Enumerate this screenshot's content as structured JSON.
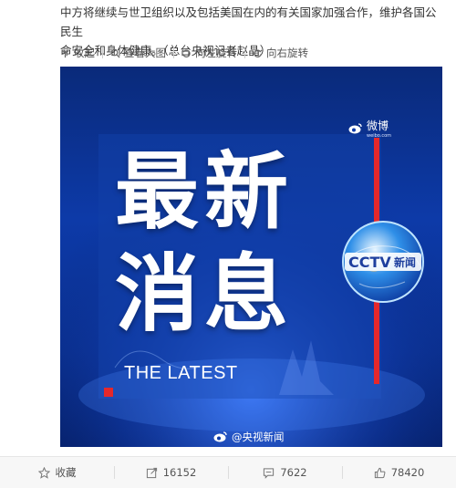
{
  "post": {
    "text_line1": "中方将继续与世卫组织以及包括美国在内的有关国家加强合作，维护各国公民生",
    "text_line2": "命安全和身体健康。（总台央视记者赵晶）"
  },
  "image_toolbar": {
    "collapse": "收起",
    "view_large": "查看大图",
    "rotate_left": "向左旋转",
    "rotate_right": "向右旋转"
  },
  "image": {
    "weibo_brand": "微博",
    "weibo_domain": "weibo.com",
    "headline_line1": "最新",
    "headline_line2": "消息",
    "latest_en": "THE LATEST",
    "cctv_logo": "CCTV",
    "cctv_news": "新闻",
    "watermark": "@央视新闻"
  },
  "actions": {
    "favorite": "收藏",
    "repost_count": "16152",
    "comment_count": "7622",
    "like_count": "78420"
  },
  "colors": {
    "accent_red": "#e5282b",
    "image_blue": "#0d3aa8"
  }
}
